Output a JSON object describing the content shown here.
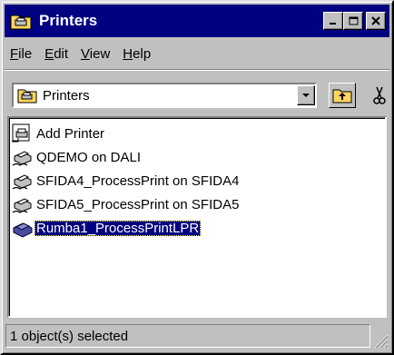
{
  "window": {
    "title": "Printers"
  },
  "menu": [
    {
      "label": "File",
      "u": "F",
      "rest": "ile"
    },
    {
      "label": "Edit",
      "u": "E",
      "rest": "dit"
    },
    {
      "label": "View",
      "u": "V",
      "rest": "iew"
    },
    {
      "label": "Help",
      "u": "H",
      "rest": "elp"
    }
  ],
  "address": {
    "value": "Printers"
  },
  "items": [
    {
      "label": "Add Printer",
      "icon": "add-printer-icon"
    },
    {
      "label": "QDEMO on DALI",
      "icon": "network-printer-icon"
    },
    {
      "label": "SFIDA4_ProcessPrint on SFIDA4",
      "icon": "network-printer-icon"
    },
    {
      "label": "SFIDA5_ProcessPrint on SFIDA5",
      "icon": "network-printer-icon"
    },
    {
      "label": "Rumba1_ProcessPrintLPR",
      "icon": "printer-icon",
      "selected": true
    }
  ],
  "status": {
    "text": "1 object(s) selected"
  },
  "colors": {
    "titlebar": "#000080",
    "face": "#c0c0c0",
    "selection": "#000080"
  }
}
